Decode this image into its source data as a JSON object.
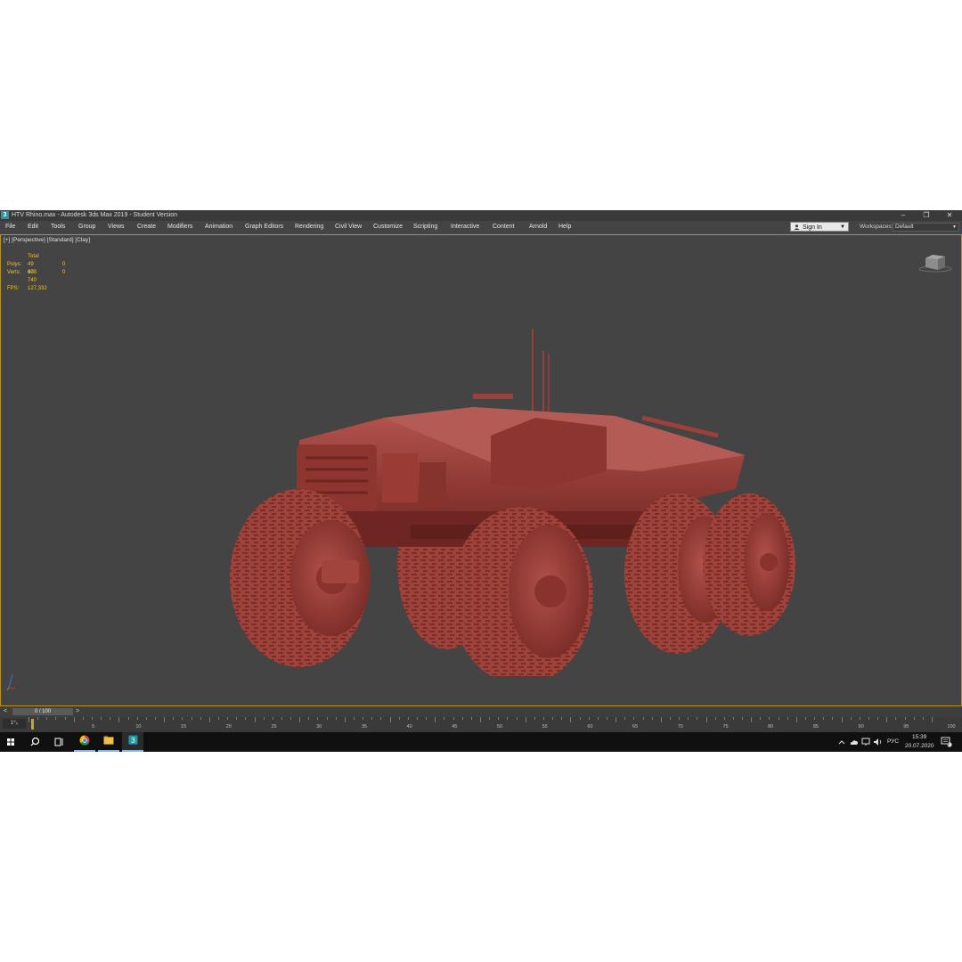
{
  "window": {
    "title": "HTV Rhino.max - Autodesk 3ds Max 2019 - Student Version",
    "logo_text": "3",
    "controls": [
      "–",
      "❐",
      "✕"
    ]
  },
  "menu": {
    "items": [
      "File",
      "Edit",
      "Tools",
      "Group",
      "Views",
      "Create",
      "Modifiers",
      "Animation",
      "Graph Editors",
      "Rendering",
      "Civil View",
      "Customize",
      "Scripting",
      "Interactive",
      "Content",
      "Arnold",
      "Help"
    ],
    "sign_in": "Sign In",
    "workspaces_label": "Workspaces:",
    "workspace_value": "Default"
  },
  "viewport": {
    "label": "[+] [Perspective] [Standard] [Clay]",
    "stats": {
      "header": "Total",
      "polys_label": "Polys:",
      "polys_total": "49 478",
      "polys_selected": "0",
      "verts_label": "Verts:",
      "verts_total": "60 740",
      "verts_selected": "0",
      "fps_label": "FPS:",
      "fps_value": "127,332"
    },
    "border_color": "#b8921e",
    "model_color": "#a8453f"
  },
  "timeline": {
    "prev": "<",
    "next": ">",
    "frame_display": "0 / 100",
    "key_mode": "1⁰₀",
    "ticks": [
      "5",
      "10",
      "15",
      "20",
      "25",
      "30",
      "35",
      "40",
      "45",
      "50",
      "55",
      "60",
      "65",
      "70",
      "75",
      "80",
      "85",
      "90",
      "95",
      "100"
    ]
  },
  "taskbar": {
    "apps": [
      "start-icon",
      "search-icon",
      "task-view-icon",
      "chrome-icon",
      "file-explorer-icon",
      "3dsmax-icon"
    ],
    "language": "РУС",
    "time": "15:39",
    "date": "20.07.2020",
    "notification_count": "3"
  }
}
